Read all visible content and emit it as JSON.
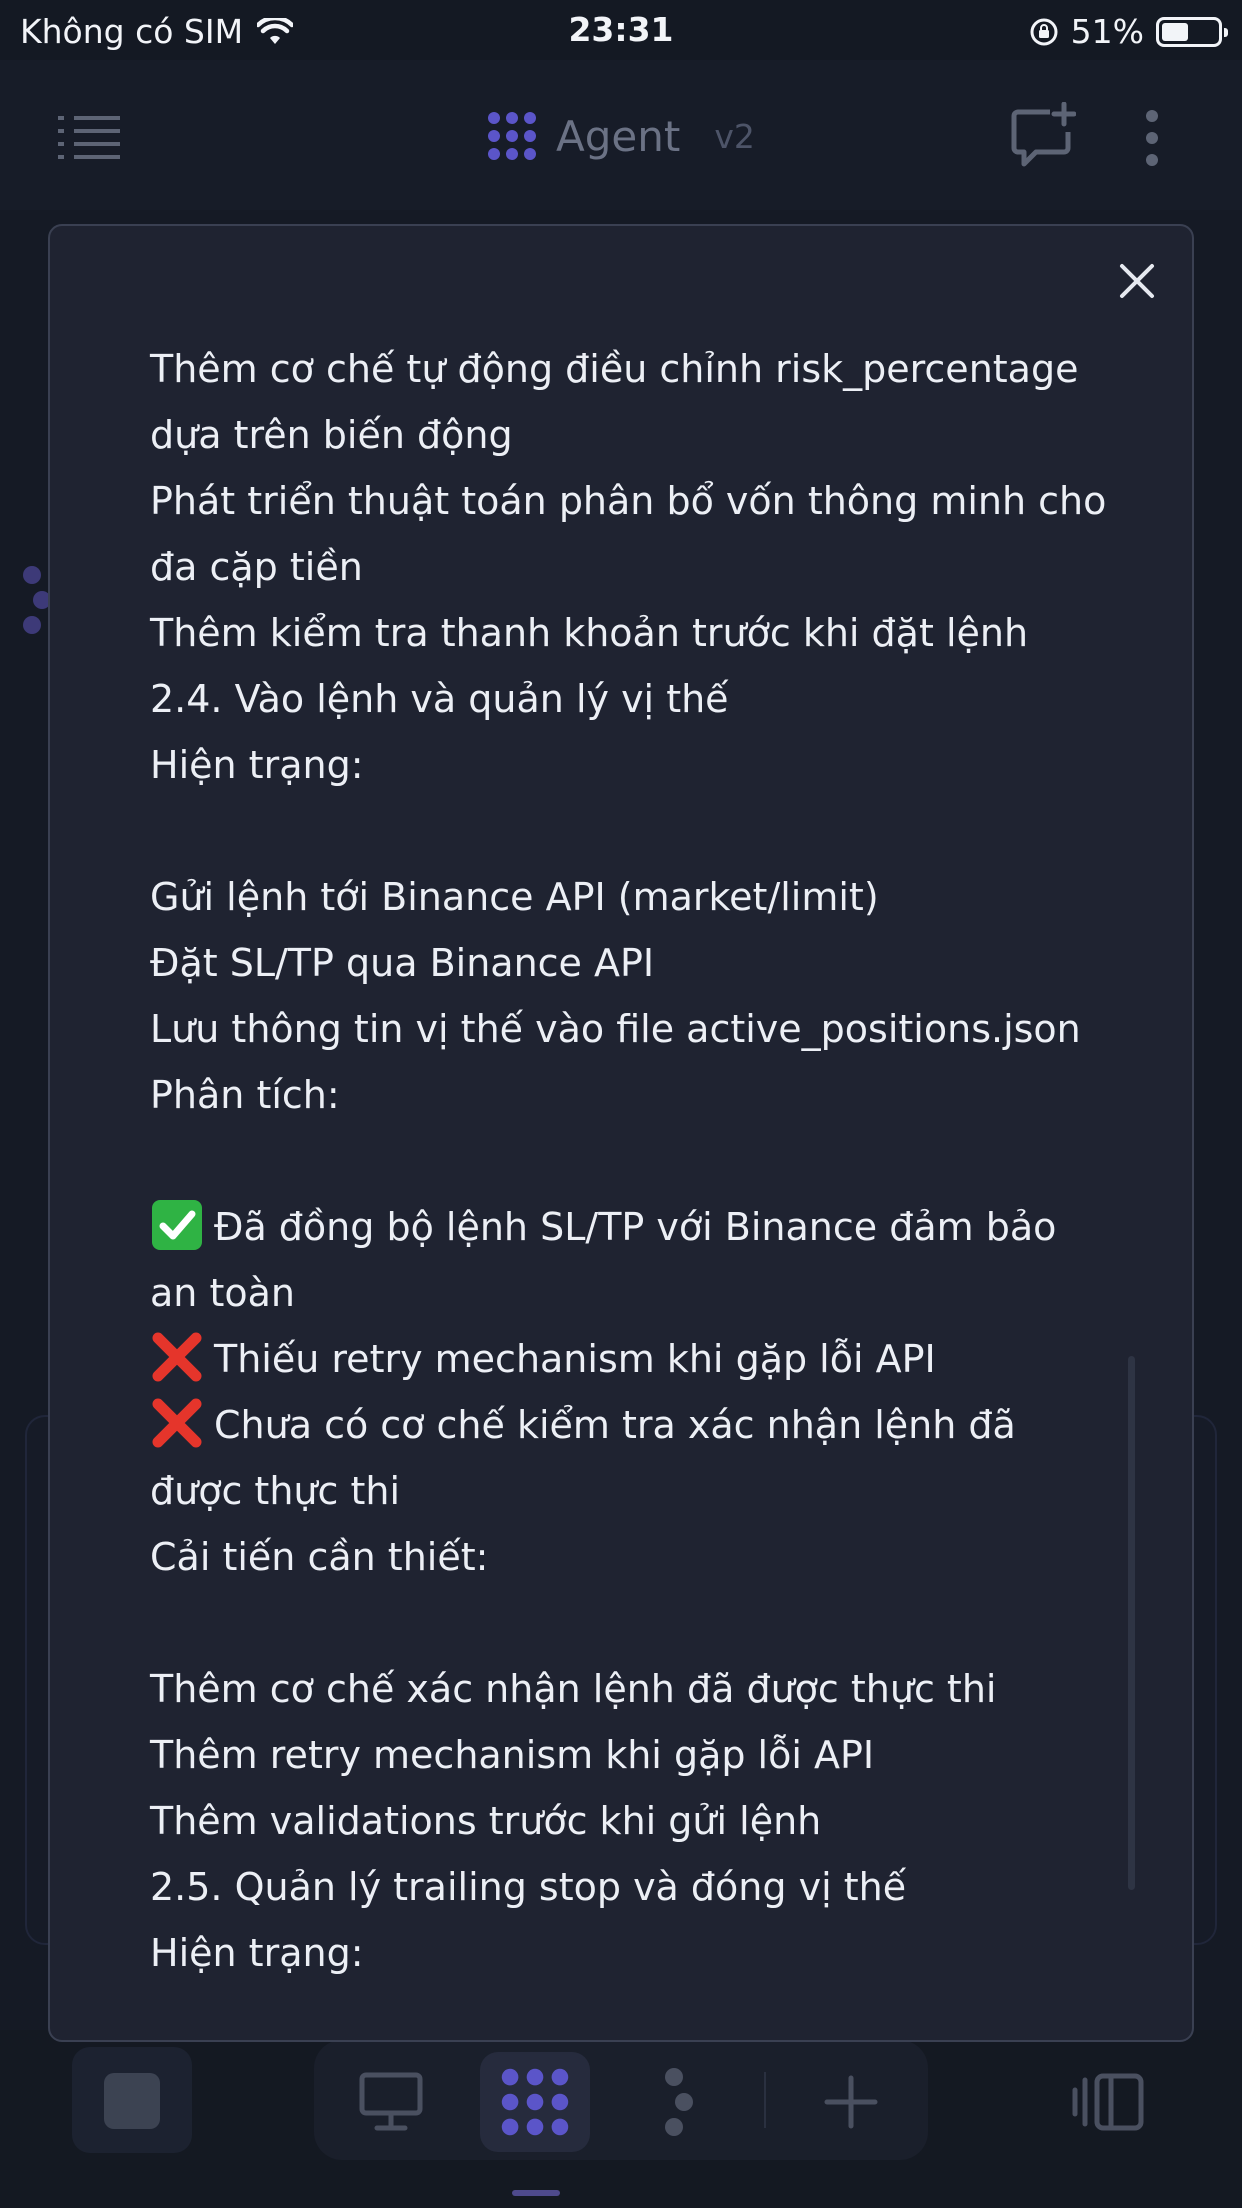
{
  "status_bar": {
    "carrier": "Không có SIM",
    "time": "23:31",
    "battery_percent": "51%",
    "battery_level": 0.51
  },
  "app_bar": {
    "title": "Agent",
    "version": "v2",
    "icons": [
      "menu-icon",
      "agent-logo-icon",
      "new-chat-icon",
      "more-vertical-icon"
    ]
  },
  "modal": {
    "close_icon": "close-icon",
    "lines": [
      {
        "text": "Thêm cơ chế tự động điều chỉnh risk_percentage"
      },
      {
        "text": "dựa trên biến động"
      },
      {
        "text": "Phát triển thuật toán phân bổ vốn thông minh cho"
      },
      {
        "text": "đa cặp tiền"
      },
      {
        "text": "Thêm kiểm tra thanh khoản trước khi đặt lệnh"
      },
      {
        "text": "2.4. Vào lệnh và quản lý vị thế"
      },
      {
        "text": "Hiện trạng:"
      },
      {
        "text": ""
      },
      {
        "text": "Gửi lệnh tới Binance API (market/limit)"
      },
      {
        "text": "Đặt SL/TP qua Binance API"
      },
      {
        "text": "Lưu thông tin vị thế vào file active_positions.json"
      },
      {
        "text": "Phân tích:"
      },
      {
        "text": ""
      },
      {
        "text": "Đã đồng bộ lệnh SL/TP với Binance đảm bảo",
        "mark": "check"
      },
      {
        "text": "an toàn"
      },
      {
        "text": "Thiếu retry mechanism khi gặp lỗi API",
        "mark": "cross"
      },
      {
        "text": "Chưa có cơ chế kiểm tra xác nhận lệnh đã",
        "mark": "cross"
      },
      {
        "text": "được thực thi"
      },
      {
        "text": "Cải tiến cần thiết:"
      },
      {
        "text": ""
      },
      {
        "text": "Thêm cơ chế xác nhận lệnh đã được thực thi"
      },
      {
        "text": "Thêm retry mechanism khi gặp lỗi API"
      },
      {
        "text": "Thêm validations trước khi gửi lệnh"
      },
      {
        "text": "2.5. Quản lý trailing stop và đóng vị thế"
      },
      {
        "text": "Hiện trạng:"
      }
    ]
  },
  "bottom_bar": {
    "items": [
      "stop-square-icon",
      "desktop-icon",
      "agent-logo-icon",
      "branch-icon",
      "plus-icon",
      "split-view-icon"
    ],
    "active": "agent-logo-icon"
  },
  "colors": {
    "background": "#151a25",
    "modal": "#1f2331",
    "accent": "#5b55c9",
    "check": "#2fb344",
    "cross": "#e5352b"
  }
}
